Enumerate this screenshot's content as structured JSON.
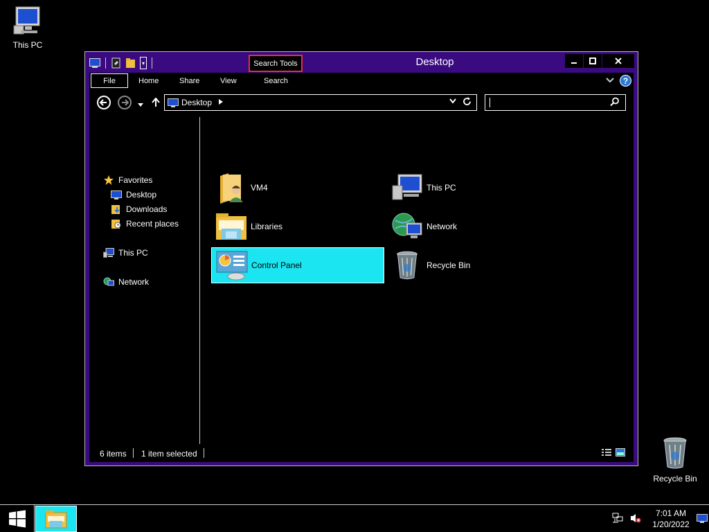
{
  "desktop": {
    "icons": [
      {
        "label": "This PC"
      },
      {
        "label": "Recycle Bin"
      }
    ]
  },
  "window": {
    "title": "Desktop",
    "context_tab": "Search Tools",
    "controls": {
      "minimize": "minimize-icon",
      "maximize": "maximize-icon",
      "close": "close-icon"
    }
  },
  "ribbon": {
    "tabs": [
      {
        "label": "File"
      },
      {
        "label": "Home"
      },
      {
        "label": "Share"
      },
      {
        "label": "View"
      },
      {
        "label": "Search"
      }
    ],
    "help": "?"
  },
  "address": {
    "crumb": "Desktop",
    "search_value": ""
  },
  "nav_pane": {
    "favorites": "Favorites",
    "favorite_items": [
      {
        "label": "Desktop"
      },
      {
        "label": "Downloads"
      },
      {
        "label": "Recent places"
      }
    ],
    "this_pc": "This PC",
    "network": "Network"
  },
  "items": [
    {
      "name": "VM4"
    },
    {
      "name": "This PC"
    },
    {
      "name": "Libraries"
    },
    {
      "name": "Network"
    },
    {
      "name": "Control Panel",
      "selected": true
    },
    {
      "name": "Recycle Bin"
    }
  ],
  "status": {
    "count": "6 items",
    "selection": "1 item selected"
  },
  "taskbar": {
    "time": "7:01 AM",
    "date": "1/20/2022"
  },
  "colors": {
    "window_frame": "#3a0a80",
    "selection": "#1be5f0",
    "context_tab_border": "#e0343c"
  }
}
